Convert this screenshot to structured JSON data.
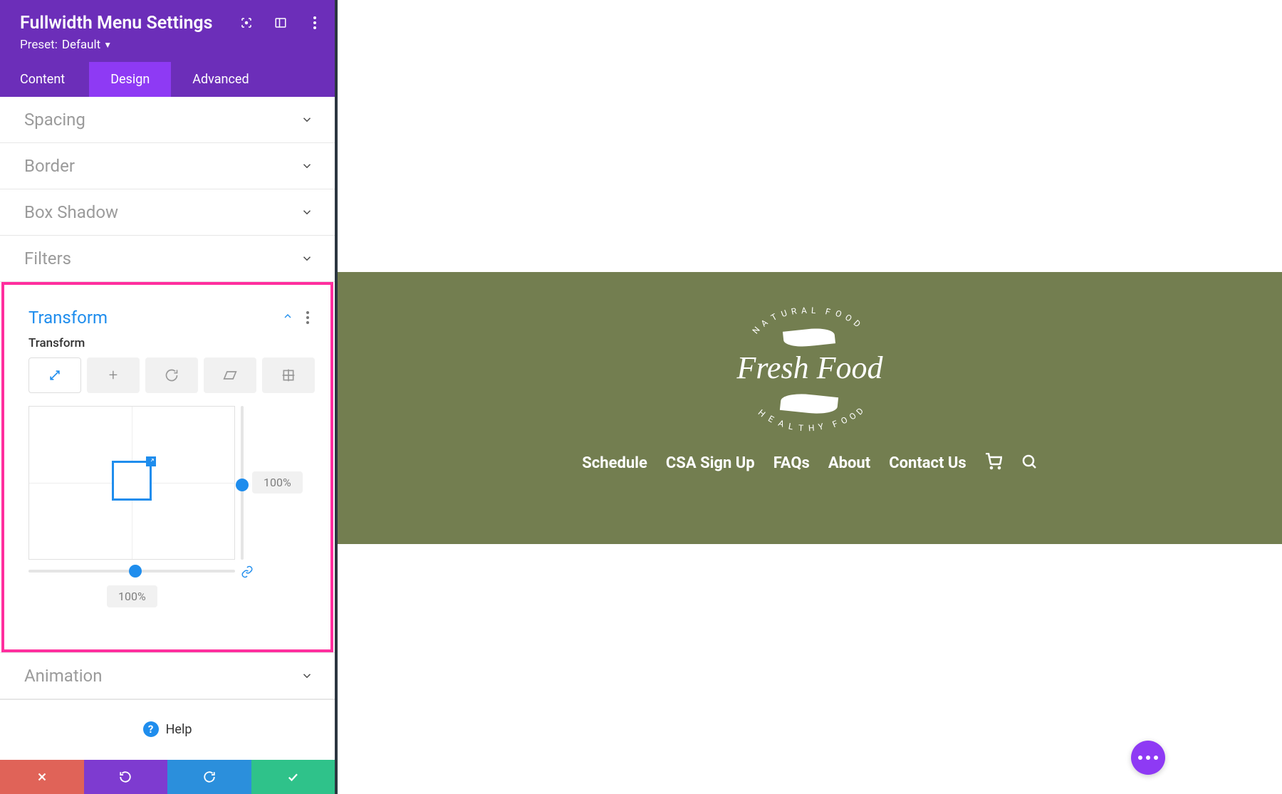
{
  "panel": {
    "title": "Fullwidth Menu Settings",
    "preset_label": "Preset:",
    "preset_value": "Default"
  },
  "tabs": {
    "content": "Content",
    "design": "Design",
    "advanced": "Advanced"
  },
  "accordion": {
    "spacing": "Spacing",
    "border": "Border",
    "box_shadow": "Box Shadow",
    "filters": "Filters",
    "transform": "Transform",
    "animation": "Animation"
  },
  "transform_panel": {
    "sublabel": "Transform",
    "value_v": "100%",
    "value_h": "100%"
  },
  "help": "Help",
  "preview_nav": {
    "schedule": "Schedule",
    "csa": "CSA Sign Up",
    "faqs": "FAQs",
    "about": "About",
    "contact": "Contact Us"
  },
  "logo": {
    "top_arc": "NATURAL FOOD",
    "main": "Fresh Food",
    "bottom_arc": "HEALTHY FOOD"
  }
}
